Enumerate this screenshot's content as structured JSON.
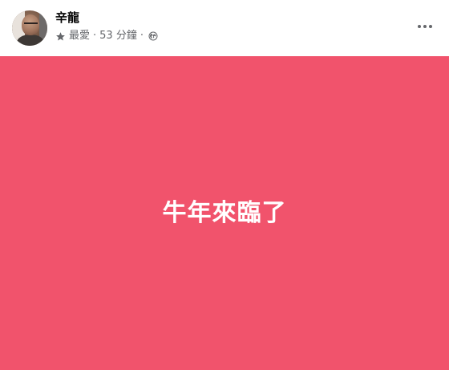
{
  "post": {
    "author": "辛龍",
    "meta": {
      "audience_label": "最愛",
      "separator": "·",
      "time": "53 分鐘",
      "privacy_icon": "globe-icon",
      "favorite_icon": "star-icon"
    },
    "text": "牛年來臨了",
    "background_color": "#f1536c",
    "more_icon": "more-options-icon"
  }
}
